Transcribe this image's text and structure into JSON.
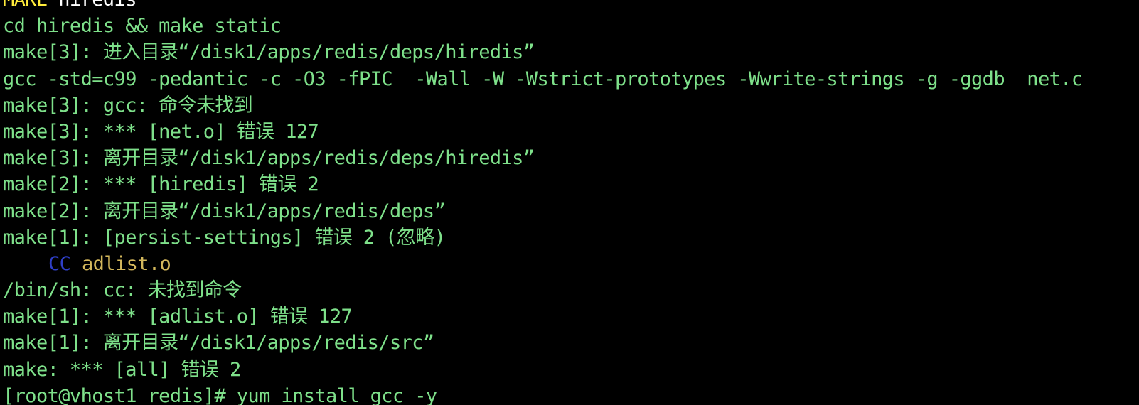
{
  "colors": {
    "background": "#000000",
    "output_text": "#7ee08a",
    "cc_label": "#2f3fc8",
    "object_file": "#d4b85c",
    "header_white": "#ffffff",
    "header_yellow": "#ffeb3b"
  },
  "terminal": {
    "header_line": {
      "keyword": "MAKE",
      "text": " hiredis"
    },
    "lines": [
      "cd hiredis && make static",
      "make[3]: 进入目录“/disk1/apps/redis/deps/hiredis”",
      "gcc -std=c99 -pedantic -c -O3 -fPIC  -Wall -W -Wstrict-prototypes -Wwrite-strings -g -ggdb  net.c",
      "make[3]: gcc: 命令未找到",
      "make[3]: *** [net.o] 错误 127",
      "make[3]: 离开目录“/disk1/apps/redis/deps/hiredis”",
      "make[2]: *** [hiredis] 错误 2",
      "make[2]: 离开目录“/disk1/apps/redis/deps”",
      "make[1]: [persist-settings] 错误 2 (忽略)"
    ],
    "cc_line": {
      "label": "CC",
      "file": "adlist.o"
    },
    "lines_after": [
      "/bin/sh: cc: 未找到命令",
      "make[1]: *** [adlist.o] 错误 127",
      "make[1]: 离开目录“/disk1/apps/redis/src”",
      "make: *** [all] 错误 2"
    ],
    "prompt_line": "[root@vhost1 redis]# yum install gcc -y"
  }
}
